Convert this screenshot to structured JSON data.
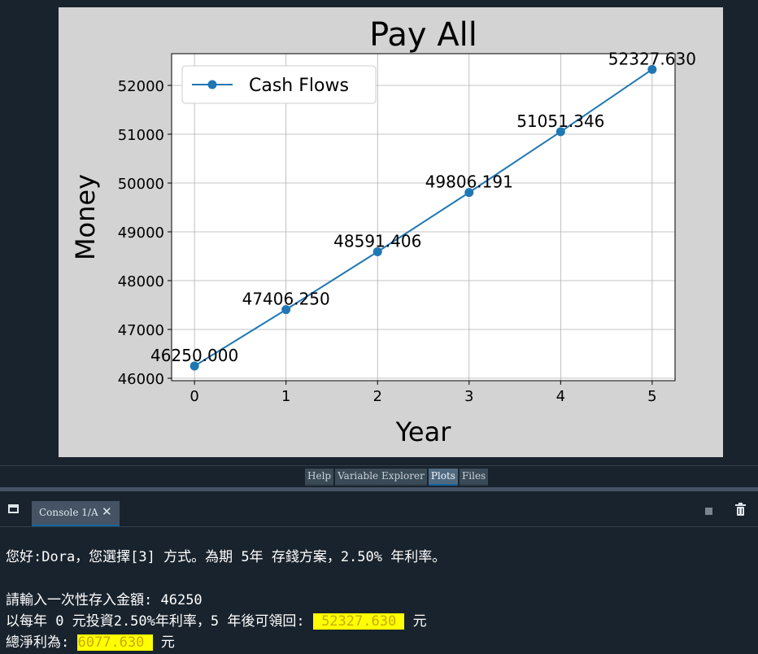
{
  "plots": {
    "chart_data": {
      "type": "line",
      "title": "Pay All",
      "xlabel": "Year",
      "ylabel": "Money",
      "x": [
        0,
        1,
        2,
        3,
        4,
        5
      ],
      "series": [
        {
          "name": "Cash Flows",
          "values": [
            46250.0,
            47406.25,
            48591.406,
            49806.191,
            51051.346,
            52327.63
          ],
          "color": "#1f77b4"
        }
      ],
      "point_labels": [
        "46250.000",
        "47406.250",
        "48591.406",
        "49806.191",
        "51051.346",
        "52327.630"
      ],
      "x_ticks": [
        "0",
        "1",
        "2",
        "3",
        "4",
        "5"
      ],
      "y_ticks": [
        46000,
        47000,
        48000,
        49000,
        50000,
        51000,
        52000
      ],
      "xlim": [
        -0.25,
        5.25
      ],
      "ylim": [
        45950,
        52650
      ],
      "grid": true,
      "legend": "top-left",
      "background": "#d3d3d3"
    }
  },
  "pane_tabs": [
    {
      "label": "Help",
      "active": false
    },
    {
      "label": "Variable Explorer",
      "active": false
    },
    {
      "label": "Plots",
      "active": true
    },
    {
      "label": "Files",
      "active": false
    }
  ],
  "console": {
    "tab_label": "Console 1/A",
    "close_glyph": "✕",
    "line1": "您好:Dora，您選擇[3] 方式。為期 5年 存錢方案，2.50% 年利率。",
    "line2_prefix": "請輸入一次性存入金額: ",
    "line2_value": "46250",
    "line3_prefix": "以每年 0 元投資2.50%年利率，5 年後可領回: ",
    "line3_value": " 52327.630 ",
    "line3_suffix": " 元",
    "line4_prefix": "總淨利為: ",
    "line4_value": "6077.630 ",
    "line4_suffix": " 元"
  },
  "icons": {
    "window": "window-icon",
    "stop": "stop-icon",
    "trash": "trash-icon"
  }
}
